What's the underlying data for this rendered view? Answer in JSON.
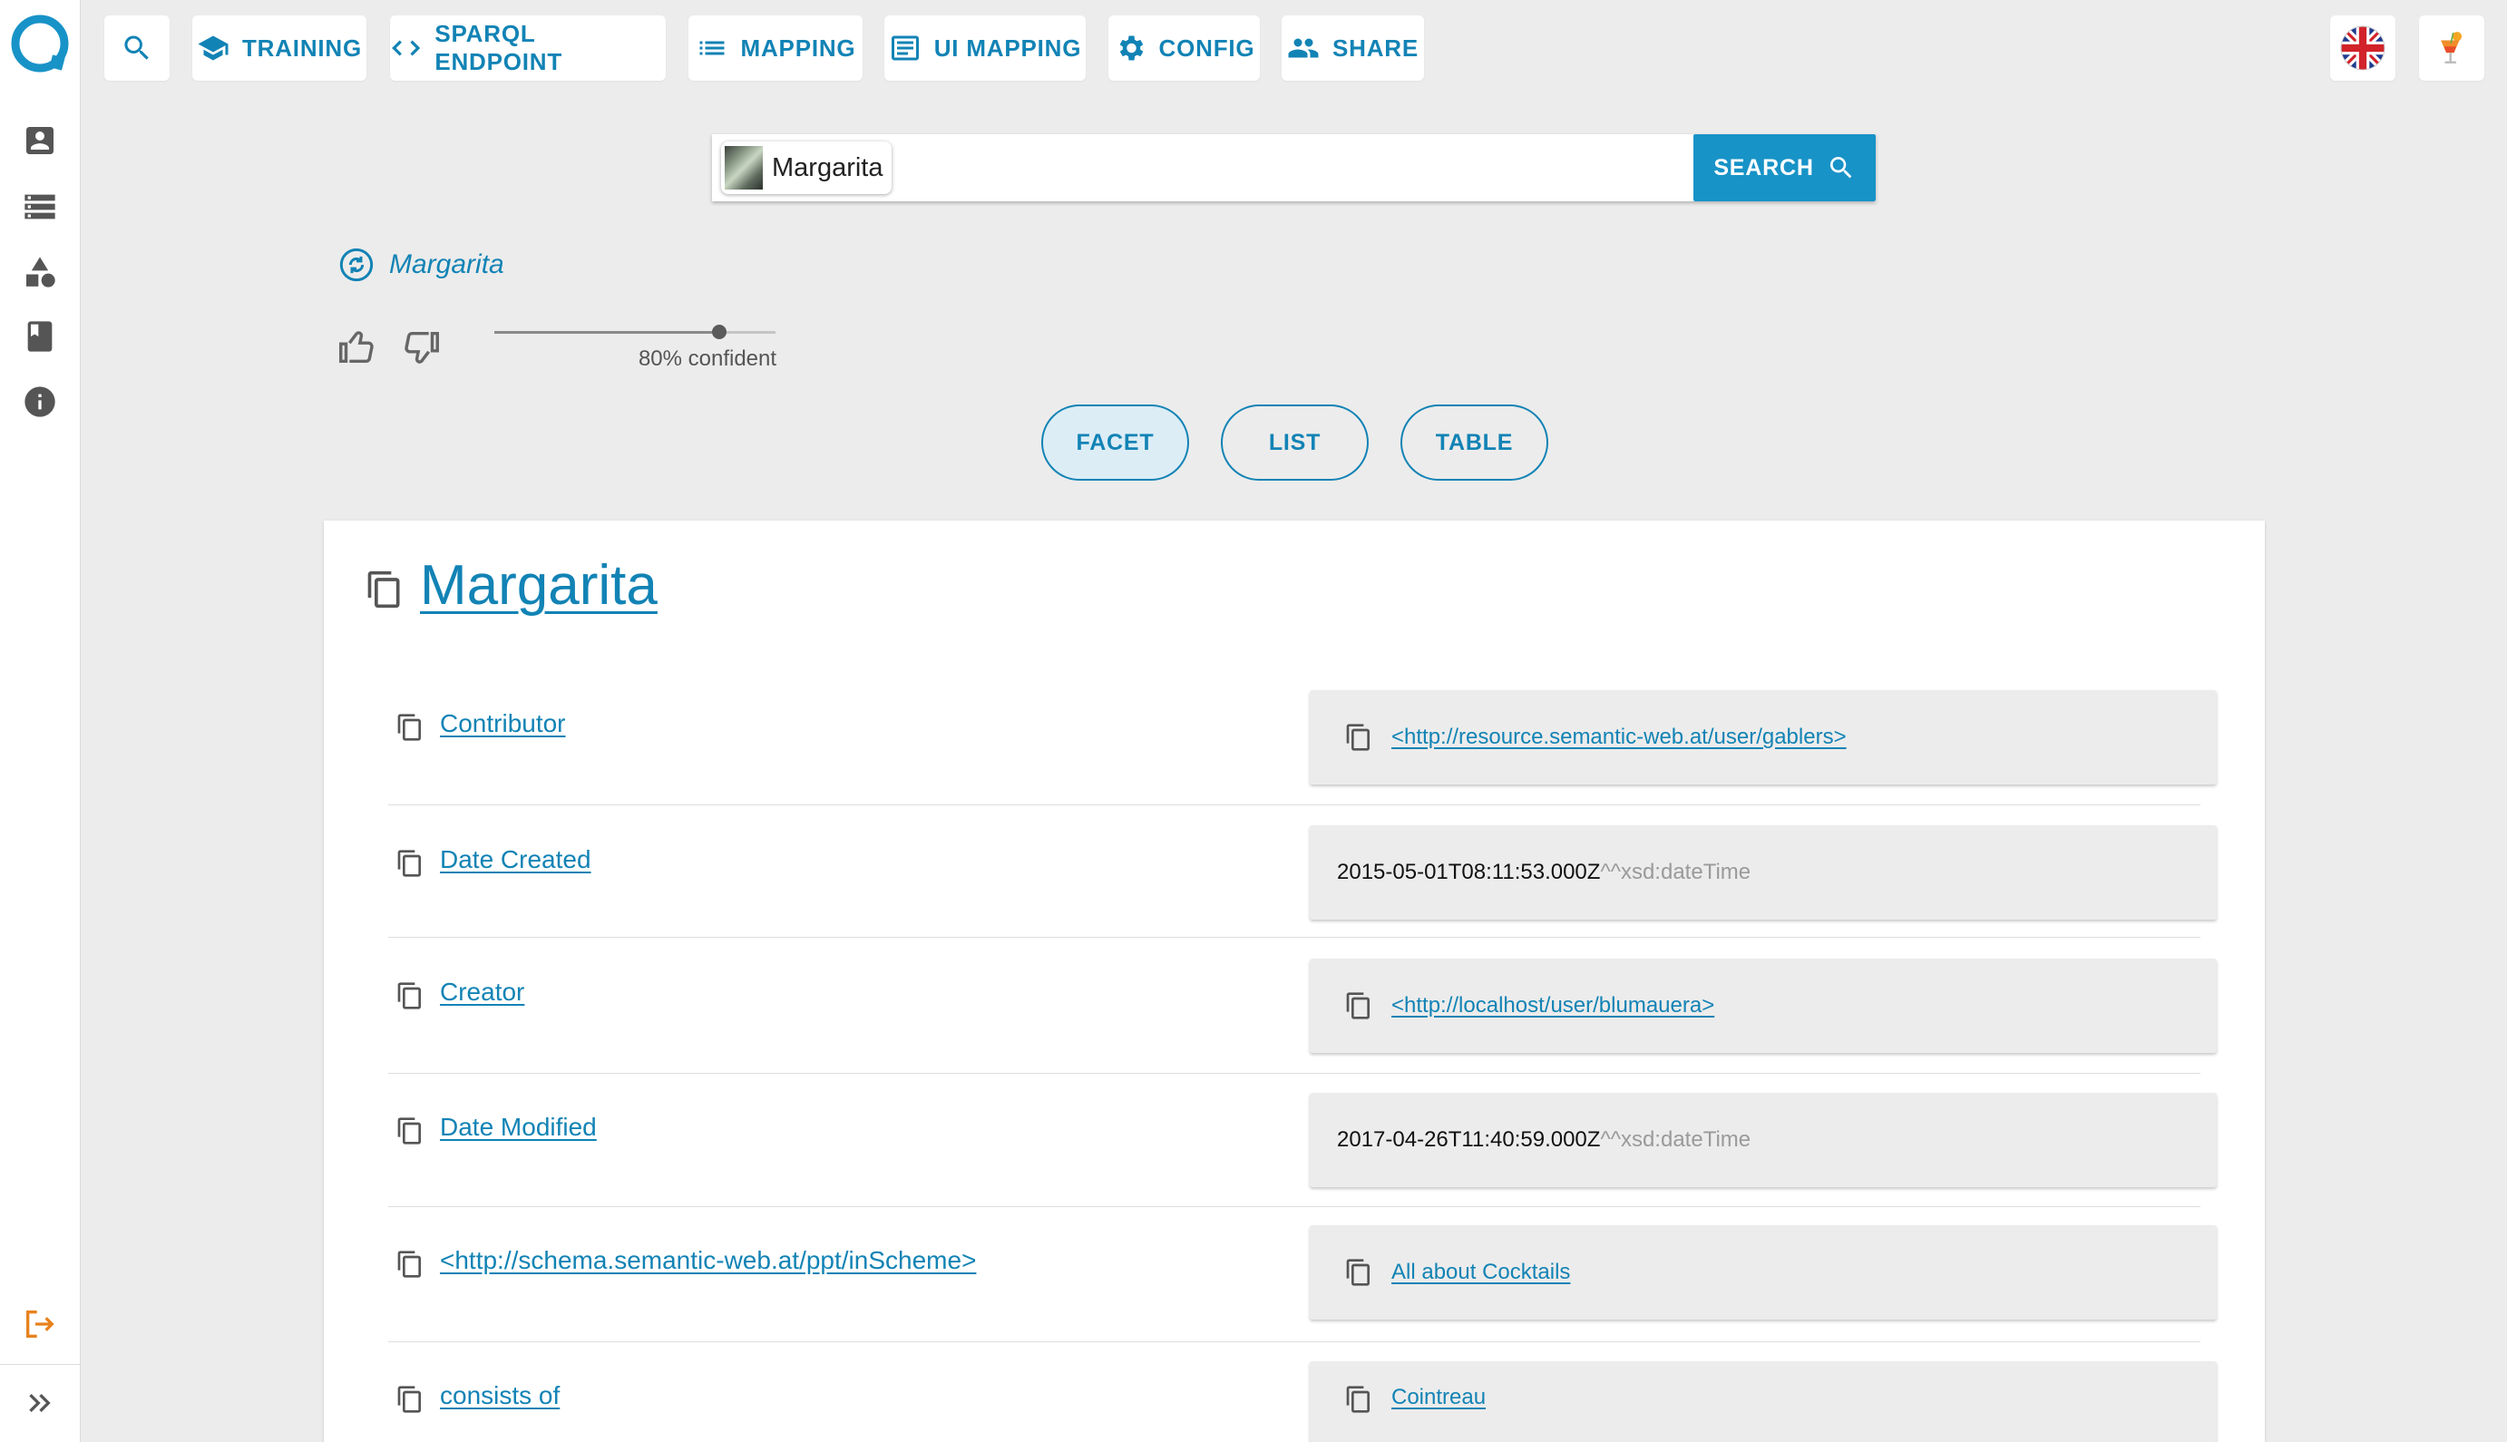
{
  "sidebar": {
    "items": [
      {
        "icon": "person-card-icon"
      },
      {
        "icon": "storage-icon"
      },
      {
        "icon": "shapes-icon"
      },
      {
        "icon": "book-icon"
      },
      {
        "icon": "info-icon"
      }
    ],
    "bottom": [
      {
        "icon": "logout-icon"
      },
      {
        "icon": "expand-double-chevron-icon"
      }
    ]
  },
  "toolbar": {
    "search_icon": "search-icon",
    "items": [
      {
        "label": "TRAINING",
        "icon": "school-icon"
      },
      {
        "label": "SPARQL ENDPOINT",
        "icon": "code-icon"
      },
      {
        "label": "MAPPING",
        "icon": "list-icon"
      },
      {
        "label": "UI MAPPING",
        "icon": "ui-list-icon"
      },
      {
        "label": "CONFIG",
        "icon": "gear-icon"
      },
      {
        "label": "SHARE",
        "icon": "people-icon"
      }
    ],
    "language_icon": "uk-flag-icon",
    "profile_icon": "cocktail-icon"
  },
  "search": {
    "chip_label": "Margarita",
    "button_label": "SEARCH"
  },
  "concept": {
    "name": "Margarita",
    "confidence_value": 0.8,
    "confidence_label": "80% confident"
  },
  "views": {
    "facet": "FACET",
    "list": "LIST",
    "table": "TABLE",
    "active": "facet"
  },
  "card": {
    "title": "Margarita",
    "rows": [
      {
        "label": "Contributor",
        "value_link": "<http://resource.semantic-web.at/user/gablers>"
      },
      {
        "label": "Date Created",
        "value_text": "2015-05-01T08:11:53.000Z",
        "value_type": "^^xsd:dateTime"
      },
      {
        "label": "Creator",
        "value_link": "<http://localhost/user/blumauera>"
      },
      {
        "label": "Date Modified",
        "value_text": "2017-04-26T11:40:59.000Z",
        "value_type": "^^xsd:dateTime"
      },
      {
        "label": "<http://schema.semantic-web.at/ppt/inScheme>",
        "value_link": "All about Cocktails"
      },
      {
        "label": "consists of",
        "value_link": "Cointreau"
      }
    ]
  },
  "colors": {
    "accent": "#1283b5",
    "button": "#1893c7",
    "logout": "#e8821e",
    "background": "#ececec"
  }
}
